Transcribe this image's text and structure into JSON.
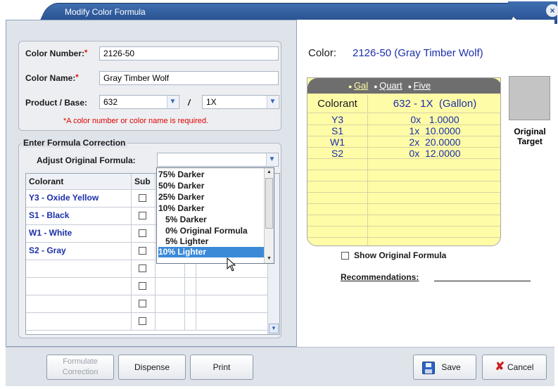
{
  "window": {
    "title": "Modify Color Formula",
    "close_glyph": "×"
  },
  "form": {
    "color_number_label": "Color Number:",
    "color_number_value": "2126-50",
    "color_name_label": "Color Name:",
    "color_name_value": "Gray Timber Wolf",
    "product_base_label": "Product / Base:",
    "product_value": "632",
    "separator": "/",
    "base_value": "1X",
    "required_marker": "*",
    "required_note": "*A color number or color name is required."
  },
  "correction": {
    "group_title": "Enter Formula Correction",
    "adjust_label": "Adjust Original Formula:",
    "adjust_value": "",
    "dropdown_options": [
      "75% Darker",
      "50% Darker",
      "25% Darker",
      "10% Darker",
      "5% Darker",
      "0% Original Formula",
      "5% Lighter",
      "10% Lighter"
    ],
    "selected_option": "10% Lighter"
  },
  "grid": {
    "headers": [
      "Colorant",
      "Sub"
    ],
    "rows": [
      {
        "colorant": "Y3 - Oxide Yellow"
      },
      {
        "colorant": "S1 - Black"
      },
      {
        "colorant": "W1 - White"
      },
      {
        "colorant": "S2 - Gray"
      },
      {
        "colorant": ""
      },
      {
        "colorant": ""
      },
      {
        "colorant": ""
      },
      {
        "colorant": ""
      }
    ]
  },
  "buttons": {
    "formulate": "Formulate Correction",
    "dispense": "Dispense",
    "print": "Print",
    "save": "Save",
    "cancel": "Cancel"
  },
  "color_header": {
    "label": "Color:",
    "value": "2126-50 (Gray Timber Wolf)"
  },
  "formula_panel": {
    "units": [
      "Gal",
      "Quart",
      "Five"
    ],
    "selected_unit": "Gal",
    "col1_header": "Colorant",
    "col2_header": "632 - 1X  (Gallon)",
    "rows": [
      {
        "colorant": "Y3",
        "amount": "0x   1.0000"
      },
      {
        "colorant": "S1",
        "amount": "1x  10.0000"
      },
      {
        "colorant": "W1",
        "amount": "2x  20.0000"
      },
      {
        "colorant": "S2",
        "amount": "0x  12.0000"
      }
    ]
  },
  "swatch": {
    "label": "Original Target",
    "color": "#c4c4c4"
  },
  "show_original": {
    "label": "Show Original Formula",
    "checked": false
  },
  "recommendations_label": "Recommendations:",
  "colors": {
    "title_blue": "#2b5597",
    "accent_blue": "#1b2fa8",
    "required_red": "#e00000",
    "panel_yellow": "#fffca8",
    "selection_blue": "#3b8ad8"
  }
}
